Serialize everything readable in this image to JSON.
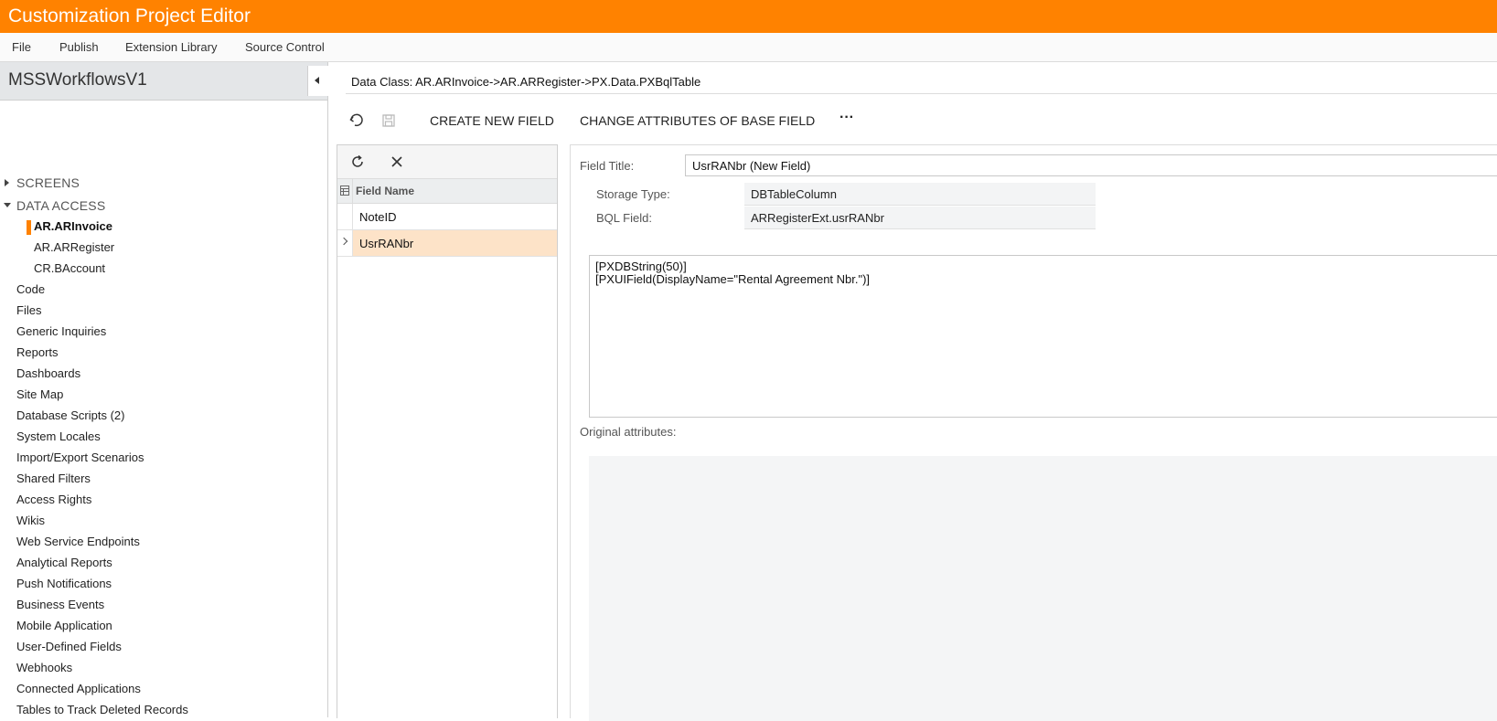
{
  "app": {
    "title": "Customization Project Editor"
  },
  "menu": {
    "items": [
      "File",
      "Publish",
      "Extension Library",
      "Source Control"
    ]
  },
  "project": {
    "name": "MSSWorkflowsV1"
  },
  "tree": {
    "screens": "SCREENS",
    "data_access": "DATA ACCESS",
    "data_access_children": [
      "AR.ARInvoice",
      "AR.ARRegister",
      "CR.BAccount"
    ],
    "items": [
      "Code",
      "Files",
      "Generic Inquiries",
      "Reports",
      "Dashboards",
      "Site Map",
      "Database Scripts (2)",
      "System Locales",
      "Import/Export Scenarios",
      "Shared Filters",
      "Access Rights",
      "Wikis",
      "Web Service Endpoints",
      "Analytical Reports",
      "Push Notifications",
      "Business Events",
      "Mobile Application",
      "User-Defined Fields",
      "Webhooks",
      "Connected Applications",
      "Tables to Track Deleted Records"
    ]
  },
  "main": {
    "data_class": "Data Class: AR.ARInvoice->AR.ARRegister->PX.Data.PXBqlTable",
    "toolbar": {
      "create_new_field": "CREATE NEW FIELD",
      "change_attributes": "CHANGE ATTRIBUTES OF BASE FIELD",
      "more": "···"
    }
  },
  "grid": {
    "column": "Field Name",
    "rows": [
      "NoteID",
      "UsrRANbr"
    ],
    "selected_row": "UsrRANbr"
  },
  "form": {
    "field_title_label": "Field Title:",
    "field_title_value": "UsrRANbr (New Field)",
    "storage_type_label": "Storage Type:",
    "storage_type_value": "DBTableColumn",
    "bql_field_label": "BQL Field:",
    "bql_field_value": "ARRegisterExt.usrRANbr",
    "code_lines": [
      "[PXDBString(50)]",
      "[PXUIField(DisplayName=\"Rental Agreement Nbr.\")]"
    ],
    "original_attributes_label": "Original attributes:"
  },
  "colors": {
    "accent": "#ff8200",
    "selected_row": "#fde3c8"
  }
}
